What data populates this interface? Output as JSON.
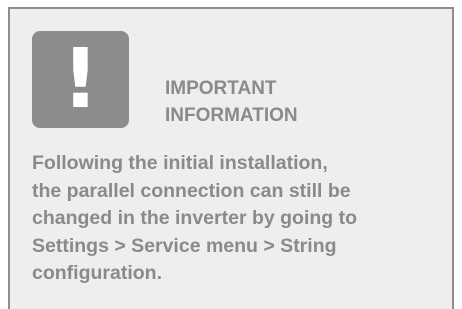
{
  "notice": {
    "icon": "exclamation-icon",
    "icon_glyph": "!",
    "title": "IMPORTANT\nINFORMATION",
    "body": "Following the initial installation,\nthe parallel connection can still be\nchanged in the inverter by going to\nSettings > Service menu > String\nconfiguration."
  },
  "colors": {
    "box_background": "#eeeeee",
    "border": "#8e8e8e",
    "icon_background": "#8c8c8c",
    "text": "#8a8a8a"
  }
}
